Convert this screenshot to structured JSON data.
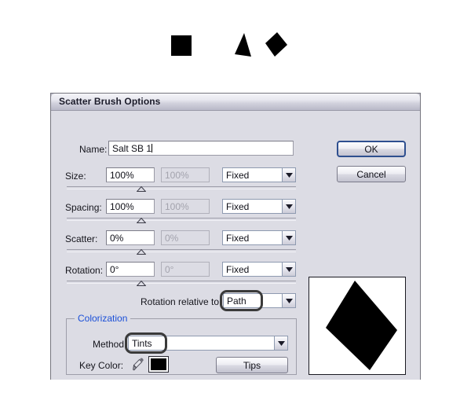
{
  "artwork": {
    "caption": "",
    "shapes": [
      {
        "name": "square-shape",
        "kind": "square",
        "color": "#000000"
      },
      {
        "name": "triangle-shape",
        "kind": "triangle",
        "color": "#000000"
      },
      {
        "name": "diamond-shape",
        "kind": "diamond",
        "color": "#000000"
      }
    ]
  },
  "dialog": {
    "title": "Scatter Brush Options",
    "name_row": {
      "label": "Name:",
      "value": "Salt SB 1"
    },
    "rows": [
      {
        "label": "Size:",
        "value": "100%",
        "value2": "100%",
        "mode": "Fixed",
        "slider_percent": 50
      },
      {
        "label": "Spacing:",
        "value": "100%",
        "value2": "100%",
        "mode": "Fixed",
        "slider_percent": 50
      },
      {
        "label": "Scatter:",
        "value": "0%",
        "value2": "0%",
        "mode": "Fixed",
        "slider_percent": 50
      },
      {
        "label": "Rotation:",
        "value": "0°",
        "value2": "0°",
        "mode": "Fixed",
        "slider_percent": 50
      }
    ],
    "rotation_relative": {
      "label": "Rotation relative to:",
      "value": "Path",
      "highlighted": true
    },
    "colorization": {
      "legend": "Colorization",
      "legend_color": "#1a4fd8",
      "method": {
        "label": "Method:",
        "value": "Tints",
        "highlighted": true
      },
      "key_color": {
        "label": "Key Color:",
        "eyedropper_icon": "eyedropper-icon",
        "swatch_color": "#000000"
      },
      "tips_button": "Tips"
    },
    "buttons": {
      "ok": "OK",
      "cancel": "Cancel"
    },
    "preview": {
      "shape": "diamond",
      "shape_color": "#000000",
      "background": "#ffffff"
    }
  }
}
